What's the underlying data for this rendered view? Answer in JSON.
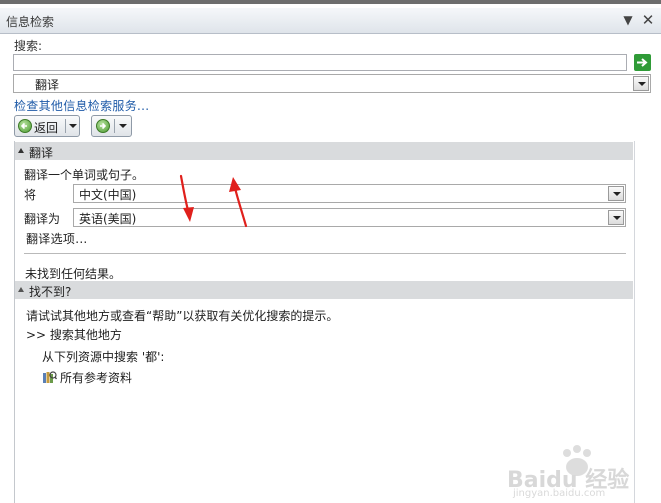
{
  "pane": {
    "title": "信息检索",
    "menu_icon": "dropdown-menu-icon",
    "close_icon": "close-icon"
  },
  "search": {
    "label": "搜索:",
    "value": "",
    "go_icon": "arrow-right-icon"
  },
  "service_select": {
    "value": "翻译"
  },
  "check_other_services_link": "检查其他信息检索服务...",
  "toolbar": {
    "back_label": "返回",
    "back_icon": "back-arrow-icon",
    "forward_icon": "forward-arrow-icon"
  },
  "translate_section": {
    "header": "翻译",
    "instruction": "翻译一个单词或句子。",
    "from_label": "将",
    "from_value": "中文(中国)",
    "to_label": "翻译为",
    "to_value": "英语(美国)",
    "options_link": "翻译选项...",
    "no_results": "未找到任何结果。"
  },
  "not_found_section": {
    "header": "找不到?",
    "hint": "请试试其他地方或查看“帮助”以获取有关优化搜索的提示。",
    "search_elsewhere": ">> 搜索其他地方",
    "search_from": "从下列资源中搜索 '都':",
    "all_refs_link": "所有参考资料",
    "all_refs_icon": "reference-books-icon"
  },
  "watermark": {
    "text": "Baidu 经验",
    "subtext": "jingyan.baidu.com"
  },
  "colors": {
    "link": "#1f5ba8",
    "section_bar": "#d9dbdd",
    "annotation_arrow": "#e0201c",
    "go_button": "#2f9b37"
  }
}
